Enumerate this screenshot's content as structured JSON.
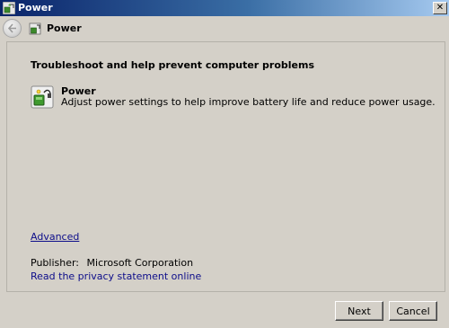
{
  "window": {
    "title": "Power",
    "close_label": "✕",
    "colors": {
      "titlebar_start": "#0a246a",
      "titlebar_end": "#a6caf0",
      "link": "#0d0d8a",
      "face": "#d4d0c8"
    }
  },
  "nav": {
    "back_icon": "back-arrow-icon",
    "title": "Power",
    "icon": "power-troubleshooter-icon"
  },
  "main": {
    "heading": "Troubleshoot and help prevent computer problems",
    "task": {
      "icon": "battery-plug-icon",
      "title": "Power",
      "description": "Adjust power settings to help improve battery life and reduce power usage."
    },
    "advanced_link": "Advanced",
    "publisher": {
      "label": "Publisher:",
      "value": "Microsoft Corporation"
    },
    "privacy_link": "Read the privacy statement online"
  },
  "footer": {
    "next_label": "Next",
    "cancel_label": "Cancel"
  }
}
